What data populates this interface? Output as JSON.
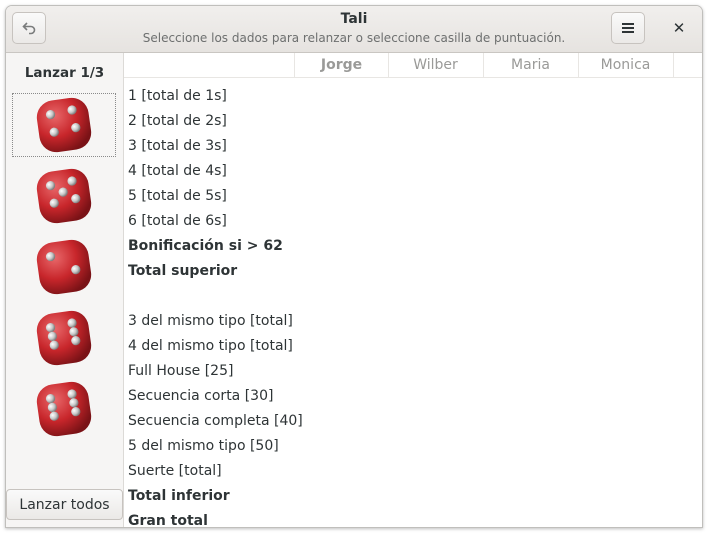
{
  "window": {
    "title": "Tali",
    "subtitle": "Seleccione los dados para relanzar o seleccione casilla de puntuación."
  },
  "sidebar": {
    "roll_label": "Lanzar 1/3",
    "roll_all_label": "Lanzar todos",
    "dice": [
      {
        "value": 4,
        "selected": true
      },
      {
        "value": 5,
        "selected": false
      },
      {
        "value": 2,
        "selected": false
      },
      {
        "value": 6,
        "selected": false
      },
      {
        "value": 6,
        "selected": false
      }
    ]
  },
  "players": [
    "Jorge",
    "Wilber",
    "Maria",
    "Monica"
  ],
  "rows": [
    {
      "label": "1 [total de 1s]",
      "bold": false
    },
    {
      "label": "2 [total de 2s]",
      "bold": false
    },
    {
      "label": "3 [total de 3s]",
      "bold": false
    },
    {
      "label": "4 [total de 4s]",
      "bold": false
    },
    {
      "label": "5 [total de 5s]",
      "bold": false
    },
    {
      "label": "6 [total de 6s]",
      "bold": false
    },
    {
      "label": "Bonificación si > 62",
      "bold": true
    },
    {
      "label": "Total superior",
      "bold": true
    },
    {
      "label": "",
      "bold": false
    },
    {
      "label": "3 del mismo tipo [total]",
      "bold": false
    },
    {
      "label": "4 del mismo tipo [total]",
      "bold": false
    },
    {
      "label": "Full House [25]",
      "bold": false
    },
    {
      "label": "Secuencia corta [30]",
      "bold": false
    },
    {
      "label": "Secuencia completa [40]",
      "bold": false
    },
    {
      "label": "5 del mismo tipo [50]",
      "bold": false
    },
    {
      "label": "Suerte [total]",
      "bold": false
    },
    {
      "label": "Total inferior",
      "bold": true
    },
    {
      "label": "Gran total",
      "bold": true
    }
  ],
  "colors": {
    "die_red": "#c8262b",
    "header_bg": "#e8e6e3"
  }
}
